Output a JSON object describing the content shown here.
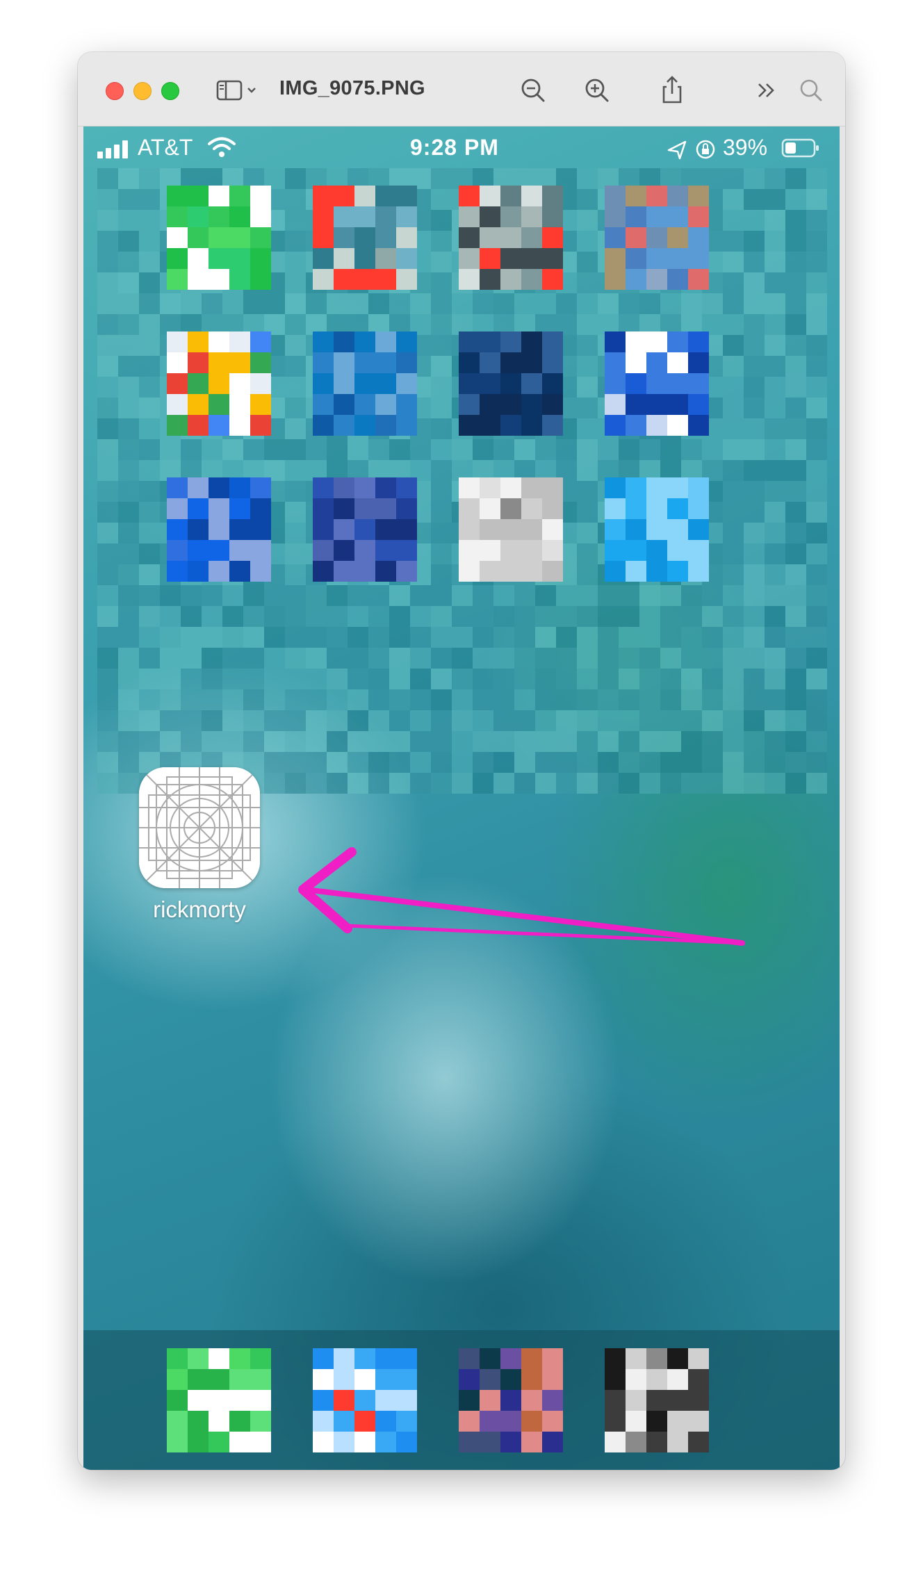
{
  "window": {
    "title": "IMG_9075.PNG",
    "toolbar": {
      "sidebar_toggle_icon": "sidebar-icon",
      "zoom_out_icon": "zoom-out-icon",
      "zoom_in_icon": "zoom-in-icon",
      "share_icon": "share-icon",
      "more_icon": "chevron-double-right-icon",
      "search_icon": "search-icon"
    }
  },
  "status_bar": {
    "carrier": "AT&T",
    "time": "9:28 PM",
    "battery_percent": "39%",
    "signal_bars": 4,
    "battery_level": 0.39
  },
  "home_screen": {
    "pixelated_rows": 3,
    "pixelated_cols": 4,
    "app": {
      "label": "rickmorty",
      "icon": "blank-app-template-icon"
    },
    "annotation": {
      "type": "arrow",
      "color": "#f01fc5"
    },
    "dock_icons": 4
  },
  "colors": {
    "traffic_red": "#fe5f57",
    "traffic_yellow": "#febc2e",
    "traffic_green": "#28c840",
    "arrow": "#f01fc5"
  }
}
